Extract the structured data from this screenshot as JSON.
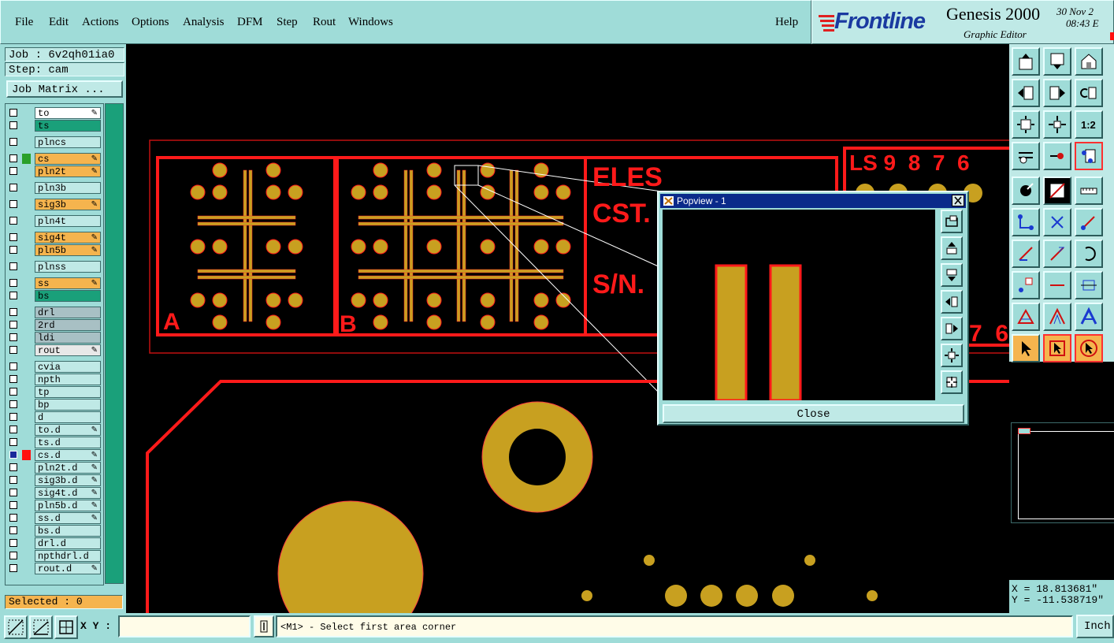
{
  "menubar": {
    "items": [
      "File",
      "Edit",
      "Actions",
      "Options",
      "Analysis",
      "DFM",
      "Step",
      "Rout",
      "Windows"
    ],
    "help": "Help"
  },
  "brand": {
    "logo": "Frontline",
    "product": "Genesis 2000",
    "subtitle": "Graphic Editor",
    "date": "30 Nov 2",
    "time": "08:43 E"
  },
  "job": {
    "job_label": "Job : 6v2qh01ia0",
    "step_label": "Step: cam",
    "matrix_button": "Job Matrix ..."
  },
  "layers": [
    {
      "name": "to",
      "color": "#ffffff",
      "edit": true
    },
    {
      "name": "ts",
      "color": "#1aa07a",
      "edit": false
    },
    {
      "name": "plncs",
      "color": "#bfe9e6",
      "edit": false
    },
    {
      "name": "cs",
      "color": "#f5b44e",
      "edit": true
    },
    {
      "name": "pln2t",
      "color": "#f5b44e",
      "edit": true
    },
    {
      "name": "pln3b",
      "color": "#bfe9e6",
      "edit": false
    },
    {
      "name": "sig3b",
      "color": "#f5b44e",
      "edit": true
    },
    {
      "name": "pln4t",
      "color": "#bfe9e6",
      "edit": false
    },
    {
      "name": "sig4t",
      "color": "#f5b44e",
      "edit": true
    },
    {
      "name": "pln5b",
      "color": "#f5b44e",
      "edit": true
    },
    {
      "name": "plnss",
      "color": "#bfe9e6",
      "edit": false
    },
    {
      "name": "ss",
      "color": "#f5b44e",
      "edit": true
    },
    {
      "name": "bs",
      "color": "#1aa07a",
      "edit": false
    },
    {
      "name": "drl",
      "color": "#a8c0c4",
      "edit": false
    },
    {
      "name": "2rd",
      "color": "#a8c0c4",
      "edit": false
    },
    {
      "name": "ldi",
      "color": "#a8c0c4",
      "edit": false
    },
    {
      "name": "rout",
      "color": "#e8e8e8",
      "edit": true
    },
    {
      "name": "cvia",
      "color": "#bfe9e6",
      "edit": false
    },
    {
      "name": "npth",
      "color": "#bfe9e6",
      "edit": false
    },
    {
      "name": "tp",
      "color": "#bfe9e6",
      "edit": false
    },
    {
      "name": "bp",
      "color": "#bfe9e6",
      "edit": false
    },
    {
      "name": "d",
      "color": "#bfe9e6",
      "edit": false
    },
    {
      "name": "to.d",
      "color": "#bfe9e6",
      "edit": true
    },
    {
      "name": "ts.d",
      "color": "#bfe9e6",
      "edit": false
    },
    {
      "name": "cs.d",
      "color": "#bfe9e6",
      "edit": true,
      "active": true
    },
    {
      "name": "pln2t.d",
      "color": "#bfe9e6",
      "edit": true
    },
    {
      "name": "sig3b.d",
      "color": "#bfe9e6",
      "edit": true
    },
    {
      "name": "sig4t.d",
      "color": "#bfe9e6",
      "edit": true
    },
    {
      "name": "pln5b.d",
      "color": "#bfe9e6",
      "edit": true
    },
    {
      "name": "ss.d",
      "color": "#bfe9e6",
      "edit": true
    },
    {
      "name": "bs.d",
      "color": "#bfe9e6",
      "edit": false
    },
    {
      "name": "drl.d",
      "color": "#bfe9e6",
      "edit": false
    },
    {
      "name": "npthdrl.d",
      "color": "#bfe9e6",
      "edit": false
    },
    {
      "name": "rout.d",
      "color": "#bfe9e6",
      "edit": true
    }
  ],
  "selected": "Selected : 0",
  "status": {
    "xy_label": "X Y :",
    "xy_value": "",
    "message": "<M1> - Select first area corner",
    "units": "Inch"
  },
  "coords": {
    "x": "X = 18.813681\"",
    "y": "Y = -11.538719\""
  },
  "popview": {
    "title": "Popview - 1",
    "close": "Close"
  },
  "canvas_text": {
    "eles": "ELES",
    "cst": "CST.",
    "sn": "S/N.",
    "ls": "LS 9  8  7  6",
    "a": "A",
    "b": "B",
    "bottom_digits": "7  6"
  },
  "colors": {
    "panel": "#9fdcd8",
    "outline": "#ff1a1a",
    "copper": "#c8a020",
    "selected": "#f5b44e"
  }
}
